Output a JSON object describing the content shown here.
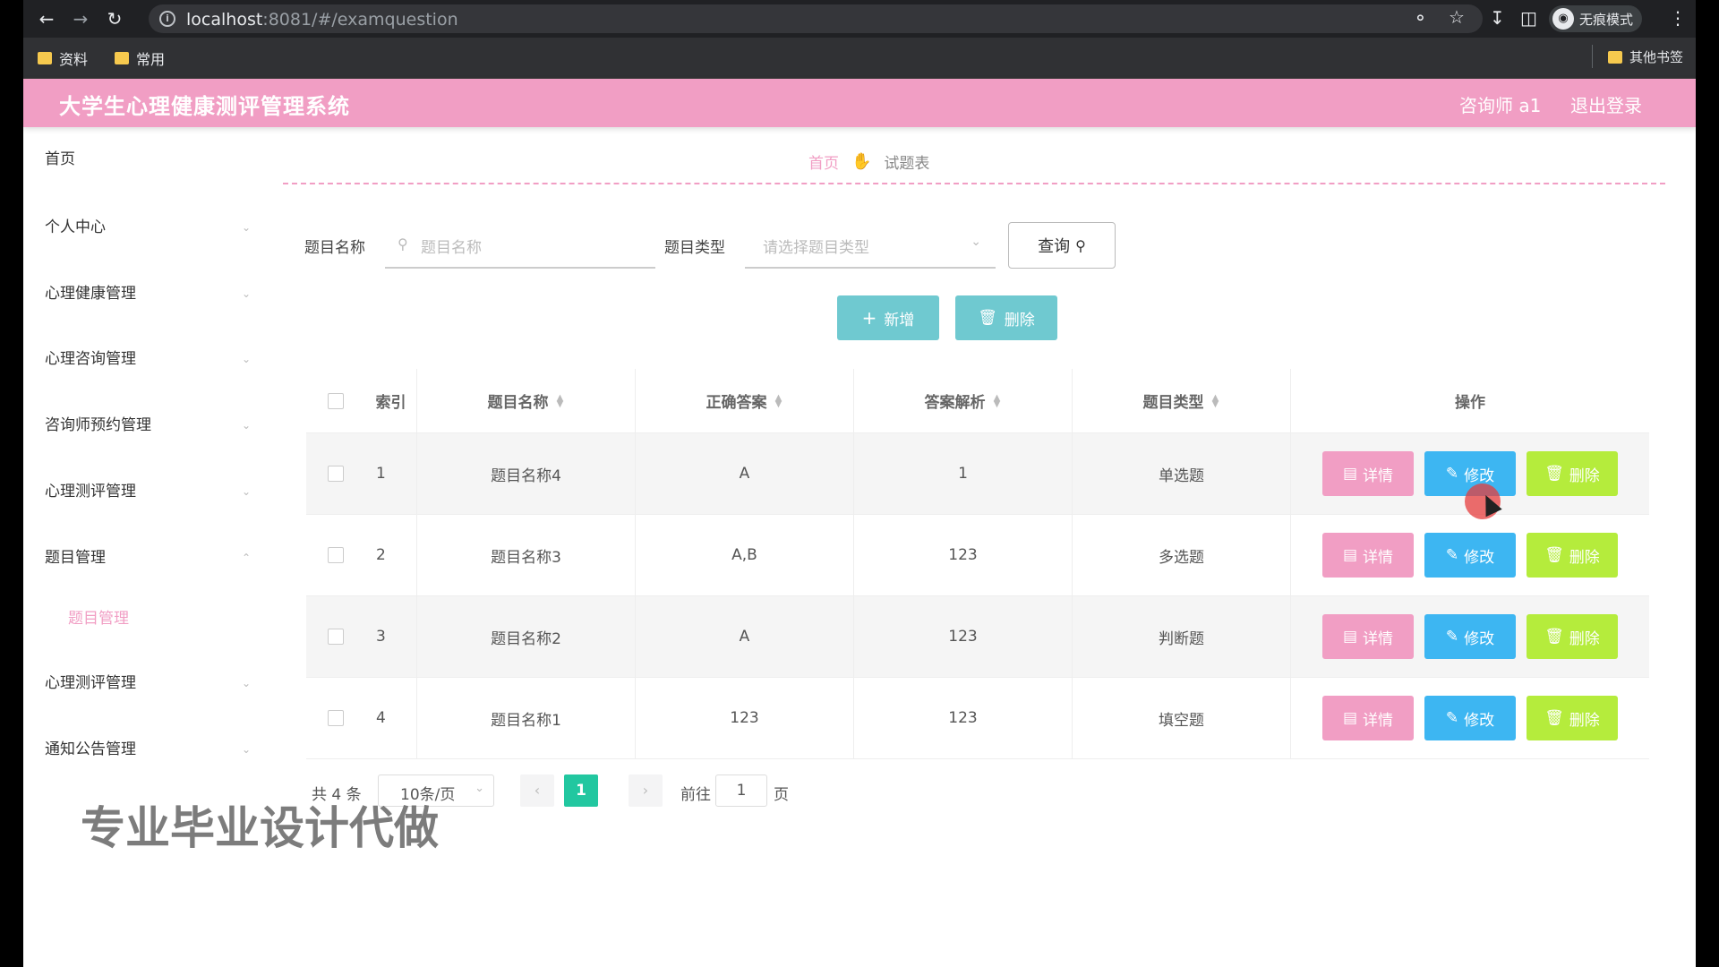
{
  "browser": {
    "url_host": "localhost",
    "url_path": ":8081/#/examquestion",
    "profile_label": "无痕模式",
    "bookmarks": [
      "资料",
      "常用"
    ],
    "other_bookmarks": "其他书签"
  },
  "header": {
    "title": "大学生心理健康测评管理系统",
    "user": "咨询师 a1",
    "logout": "退出登录"
  },
  "sidebar": {
    "items": [
      {
        "label": "首页"
      },
      {
        "label": "个人中心"
      },
      {
        "label": "心理健康管理"
      },
      {
        "label": "心理咨询管理"
      },
      {
        "label": "咨询师预约管理"
      },
      {
        "label": "心理测评管理"
      },
      {
        "label": "题目管理"
      },
      {
        "label": "心理测评管理"
      },
      {
        "label": "通知公告管理"
      }
    ],
    "sub_item": "题目管理"
  },
  "breadcrumb": {
    "home": "首页",
    "current": "试题表"
  },
  "search": {
    "name_label": "题目名称",
    "name_placeholder": "题目名称",
    "type_label": "题目类型",
    "type_placeholder": "请选择题目类型",
    "query_button": "查询"
  },
  "toolbar": {
    "add": "新增",
    "delete": "删除"
  },
  "table": {
    "headers": [
      "索引",
      "题目名称",
      "正确答案",
      "答案解析",
      "题目类型",
      "操作"
    ],
    "rows": [
      {
        "index": "1",
        "name": "题目名称4",
        "answer": "A",
        "analysis": "1",
        "type": "单选题"
      },
      {
        "index": "2",
        "name": "题目名称3",
        "answer": "A,B",
        "analysis": "123",
        "type": "多选题"
      },
      {
        "index": "3",
        "name": "题目名称2",
        "answer": "A",
        "analysis": "123",
        "type": "判断题"
      },
      {
        "index": "4",
        "name": "题目名称1",
        "answer": "123",
        "analysis": "123",
        "type": "填空题"
      }
    ],
    "actions": {
      "detail": "详情",
      "edit": "修改",
      "delete": "删除"
    }
  },
  "pagination": {
    "total": "共 4 条",
    "page_size": "10条/页",
    "current_page": "1",
    "goto_label": "前往",
    "goto_value": "1",
    "page_suffix": "页"
  },
  "watermark": "专业毕业设计代做",
  "colors": {
    "header": "#f19ec4",
    "detail": "#f19ec4",
    "edit": "#3db6f2",
    "delete": "#b5ec3c",
    "toolbar": "#6fc9d0",
    "page_active": "#22c7a0"
  }
}
